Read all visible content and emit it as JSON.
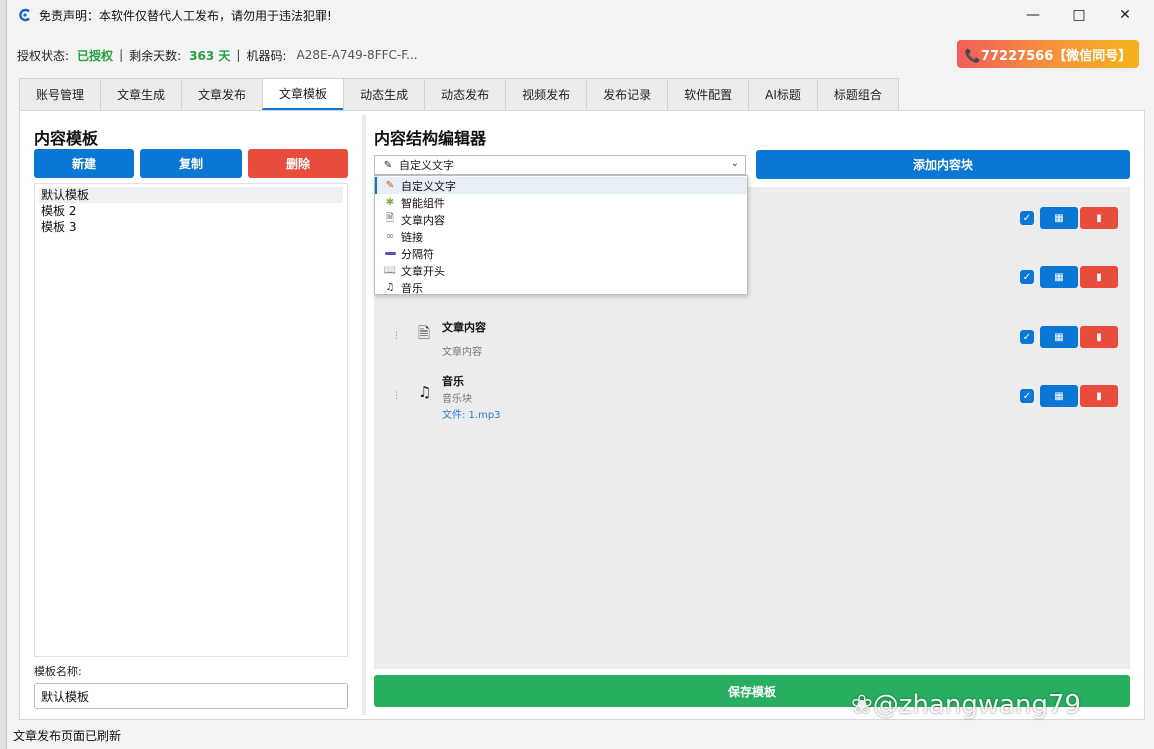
{
  "window": {
    "title": "免责声明：本软件仅替代人工发布，请勿用于违法犯罪!"
  },
  "license": {
    "status_label": "授权状态:",
    "status_value": "已授权",
    "days_label": "剩余天数:",
    "days_value": "363 天",
    "machine_label": "机器码:",
    "machine_value": "A28E-A749-8FFC-F...",
    "contact": "📞77227566【微信同号】"
  },
  "tabs": [
    "账号管理",
    "文章生成",
    "文章发布",
    "文章模板",
    "动态生成",
    "动态发布",
    "视频发布",
    "发布记录",
    "软件配置",
    "AI标题",
    "标题组合"
  ],
  "active_tab": "文章模板",
  "left": {
    "title": "内容模板",
    "new_label": "新建",
    "copy_label": "复制",
    "delete_label": "删除",
    "templates": [
      "默认模板",
      "模板 2",
      "模板 3"
    ],
    "name_label": "模板名称:",
    "name_value": "默认模板"
  },
  "right": {
    "title": "内容结构编辑器",
    "selected_type": "自定义文字",
    "add_label": "添加内容块",
    "type_options": [
      {
        "icon": "pencil-icon",
        "label": "自定义文字"
      },
      {
        "icon": "puzzle-icon",
        "label": "智能组件"
      },
      {
        "icon": "document-icon",
        "label": "文章内容"
      },
      {
        "icon": "link-icon",
        "label": "链接"
      },
      {
        "icon": "separator-icon",
        "label": "分隔符"
      },
      {
        "icon": "book-icon",
        "label": "文章开头"
      },
      {
        "icon": "music-icon",
        "label": "音乐"
      }
    ],
    "blocks": [
      {
        "icon": "document-icon",
        "title": "文章内容",
        "subtitle": "文章内容",
        "file": ""
      },
      {
        "icon": "music-icon",
        "title": "音乐",
        "subtitle": "音乐块",
        "file": "文件: 1.mp3"
      }
    ],
    "save_label": "保存模板"
  },
  "status": "文章发布页面已刷新",
  "watermark": "@zhangwang79",
  "colors": {
    "primary": "#0b77d4",
    "danger": "#e74c3c",
    "success": "#27ae60",
    "accent": "#f6913b"
  }
}
